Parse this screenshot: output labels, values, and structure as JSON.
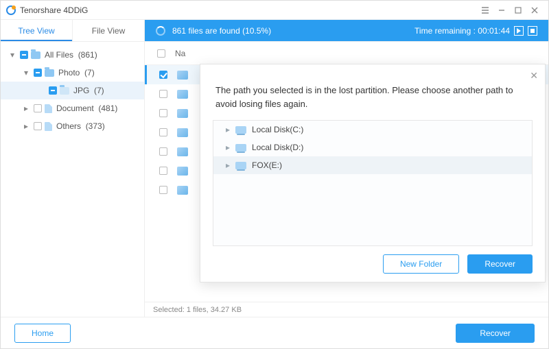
{
  "title": "Tenorshare 4DDiG",
  "tabs": {
    "tree": "Tree View",
    "file": "File View"
  },
  "status": {
    "text": "861 files are found (10.5%)",
    "remaining_label": "Time remaining :",
    "remaining_value": "00:01:44"
  },
  "tree": {
    "all": {
      "label": "All Files",
      "count": "(861)"
    },
    "photo": {
      "label": "Photo",
      "count": "(7)"
    },
    "jpg": {
      "label": "JPG",
      "count": "(7)"
    },
    "document": {
      "label": "Document",
      "count": "(481)"
    },
    "others": {
      "label": "Others",
      "count": "(373)"
    }
  },
  "list": {
    "header_name": "Na",
    "rows": 7,
    "selected_index": 0
  },
  "status_line": "Selected: 1 files, 34.27 KB",
  "footer": {
    "home": "Home",
    "recover": "Recover"
  },
  "modal": {
    "message": "The path you selected is in the lost partition. Please choose another path to avoid losing files again.",
    "drives": [
      {
        "label": "Local Disk(C:)"
      },
      {
        "label": "Local Disk(D:)"
      },
      {
        "label": "FOX(E:)"
      }
    ],
    "selected_drive": 2,
    "new_folder": "New Folder",
    "recover": "Recover"
  }
}
